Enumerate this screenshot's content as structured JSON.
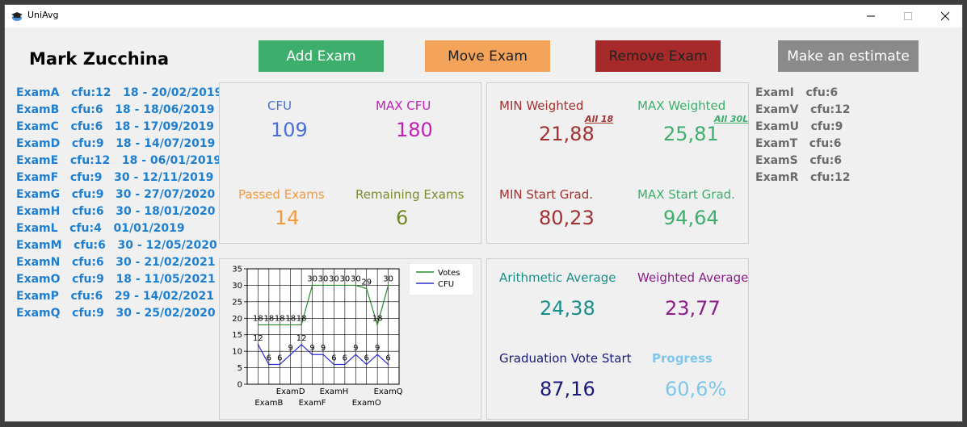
{
  "window": {
    "title": "UniAvg"
  },
  "student": {
    "name": "Mark Zucchina"
  },
  "buttons": {
    "add": "Add Exam",
    "move": "Move Exam",
    "remove": "Remove Exam",
    "estimate": "Make an estimate"
  },
  "exams": [
    "ExamA   cfu:12   18 - 20/02/2019",
    "ExamB   cfu:6   18 - 18/06/2019",
    "ExamC   cfu:6   18 - 17/09/2019",
    "ExamD   cfu:9   18 - 14/07/2019",
    "ExamE   cfu:12   18 - 06/01/2019",
    "ExamF   cfu:9   30 - 12/11/2019",
    "ExamG   cfu:9   30 - 27/07/2020",
    "ExamH   cfu:6   30 - 18/01/2020",
    "ExamL   cfu:4   01/01/2019",
    "ExamM   cfu:6   30 - 12/05/2020",
    "ExamN   cfu:6   30 - 21/02/2021",
    "ExamO   cfu:9   18 - 11/05/2021",
    "ExamP   cfu:6   29 - 14/02/2021",
    "ExamQ   cfu:9   30 - 25/02/2020"
  ],
  "stats": {
    "cfu_label": "CFU",
    "cfu_value": "109",
    "max_cfu_label": "MAX CFU",
    "max_cfu_value": "180",
    "passed_label": "Passed Exams",
    "passed_value": "14",
    "remaining_label": "Remaining Exams",
    "remaining_value": "6",
    "min_weighted_label": "MIN Weighted",
    "min_weighted_note": "All 18",
    "min_weighted_value": "21,88",
    "max_weighted_label": "MAX Weighted",
    "max_weighted_note": "All 30L",
    "max_weighted_value": "25,81",
    "min_start_label": "MIN Start Grad.",
    "min_start_value": "80,23",
    "max_start_label": "MAX Start Grad.",
    "max_start_value": "94,64",
    "arith_label": "Arithmetic Average",
    "arith_value": "24,38",
    "weighted_label": "Weighted Average",
    "weighted_value": "23,77",
    "grad_label": "Graduation Vote Start",
    "grad_value": "87,16",
    "progress_label": "Progress",
    "progress_value": "60,6%"
  },
  "remaining_exams": [
    "ExamI   cfu:6",
    "ExamV   cfu:12",
    "ExamU   cfu:9",
    "ExamT   cfu:6",
    "ExamS   cfu:6",
    "ExamR   cfu:12"
  ],
  "colors": {
    "blue_link": "#1e7fd0",
    "votes_line": "#2a8a2a",
    "cfu_line": "#2b2bd6"
  },
  "chart_data": {
    "type": "line",
    "categories": [
      "ExamA",
      "ExamB",
      "ExamC",
      "ExamD",
      "ExamE",
      "ExamF",
      "ExamG",
      "ExamH",
      "ExamM",
      "ExamN",
      "ExamO",
      "ExamP",
      "ExamQ"
    ],
    "shown_x_ticks": [
      "ExamB",
      "ExamD",
      "ExamF",
      "ExamH",
      "ExamO",
      "ExamQ"
    ],
    "series": [
      {
        "name": "Votes",
        "values": [
          18,
          18,
          18,
          18,
          18,
          30,
          30,
          30,
          30,
          30,
          29,
          18,
          30
        ],
        "color": "#2a8a2a"
      },
      {
        "name": "CFU",
        "values": [
          12,
          6,
          6,
          9,
          12,
          9,
          9,
          6,
          6,
          9,
          6,
          9,
          6
        ],
        "color": "#2b2bd6"
      }
    ],
    "ylim": [
      0,
      35
    ],
    "yticks": [
      0,
      5,
      10,
      15,
      20,
      25,
      30,
      35
    ],
    "grid": true,
    "legend": "top-right"
  }
}
